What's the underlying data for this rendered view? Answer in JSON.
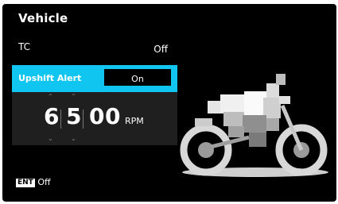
{
  "screen": {
    "title": "Vehicle",
    "tc": {
      "label": "TC",
      "value": "Off"
    },
    "upshift_alert": {
      "label": "Upshift Alert",
      "value": "On"
    },
    "rpm": {
      "digits": [
        "6",
        "5",
        "0",
        "0"
      ],
      "unit": "RPM",
      "up_arrow": "^",
      "down_arrow": "v"
    },
    "footer": {
      "key": "ENT",
      "label": "Off"
    },
    "image": "motorcycle-illustration",
    "colors": {
      "background": "#000000",
      "highlight": "#10c6f0",
      "panel": "#1f1f1f"
    }
  }
}
